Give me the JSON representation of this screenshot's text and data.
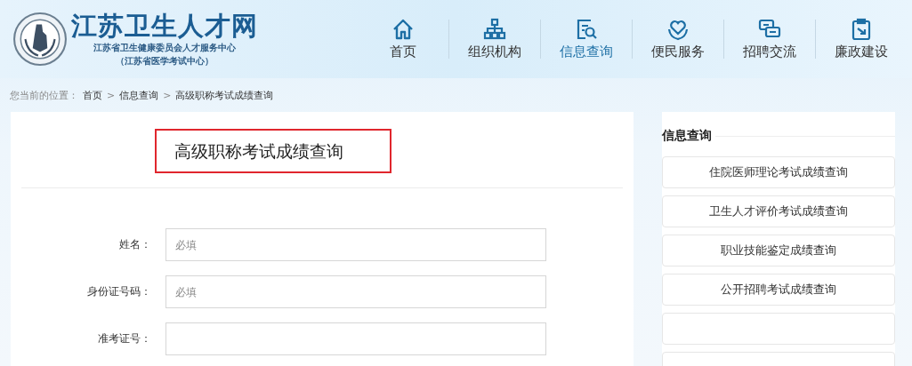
{
  "header": {
    "site_title": "江苏卫生人才网",
    "subtitle": "江苏省卫生健康委员会人才服务中心",
    "subtitle_2": "（江苏省医学考试中心）"
  },
  "nav": [
    {
      "label": "首页",
      "kind": "home",
      "selected": false
    },
    {
      "label": "组织机构",
      "kind": "org",
      "selected": false
    },
    {
      "label": "信息查询",
      "kind": "search-doc",
      "selected": true
    },
    {
      "label": "便民服务",
      "kind": "heart",
      "selected": false
    },
    {
      "label": "招聘交流",
      "kind": "chat",
      "selected": false
    },
    {
      "label": "廉政建设",
      "kind": "clip",
      "selected": false
    }
  ],
  "breadcrumb": {
    "prefix": "您当前的位置：",
    "items": [
      "首页",
      "信息查询",
      "高级职称考试成绩查询"
    ],
    "separator": ">"
  },
  "form": {
    "title": "高级职称考试成绩查询",
    "fields": [
      {
        "label": "姓名：",
        "placeholder": "必填"
      },
      {
        "label": "身份证号码：",
        "placeholder": "必填"
      },
      {
        "label": "准考证号："
      }
    ]
  },
  "sidebar": {
    "heading": "信息查询",
    "items": [
      {
        "kind": "link",
        "text": "住院医师理论考试成绩查询"
      },
      {
        "kind": "link",
        "text": "卫生人才评价考试成绩查询"
      },
      {
        "kind": "link",
        "text": "职业技能鉴定成绩查询"
      },
      {
        "kind": "link",
        "text": "公开招聘考试成绩查询"
      },
      {
        "kind": "obscured"
      },
      {
        "kind": "obscured"
      }
    ]
  }
}
